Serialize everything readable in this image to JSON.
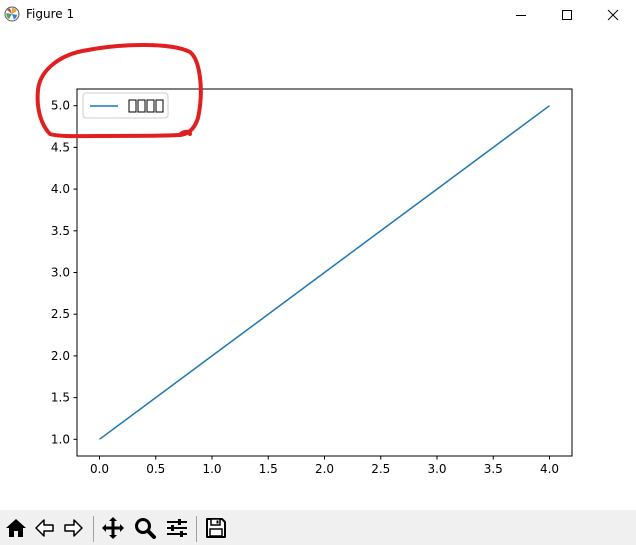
{
  "window": {
    "title": "Figure 1",
    "icons": [
      "matplotlib-logo-icon",
      "minimize-icon",
      "maximize-icon",
      "close-icon"
    ]
  },
  "chart_data": {
    "type": "line",
    "x": [
      0,
      1,
      2,
      3,
      4
    ],
    "series": [
      {
        "name": "□□□□",
        "values": [
          1,
          2,
          3,
          4,
          5
        ],
        "color": "#1f77b4"
      }
    ],
    "xlim": [
      -0.2,
      4.2
    ],
    "ylim": [
      0.8,
      5.2
    ],
    "xticks": [
      0.0,
      0.5,
      1.0,
      1.5,
      2.0,
      2.5,
      3.0,
      3.5,
      4.0
    ],
    "yticks": [
      1.0,
      1.5,
      2.0,
      2.5,
      3.0,
      3.5,
      4.0,
      4.5,
      5.0
    ],
    "xtick_labels": [
      "0.0",
      "0.5",
      "1.0",
      "1.5",
      "2.0",
      "2.5",
      "3.0",
      "3.5",
      "4.0"
    ],
    "ytick_labels": [
      "1.0",
      "1.5",
      "2.0",
      "2.5",
      "3.0",
      "3.5",
      "4.0",
      "4.5",
      "5.0"
    ],
    "legend_position": "upper left",
    "grid": false,
    "annotation": {
      "shape": "hand-drawn circle around legend",
      "color": "#e02020"
    }
  },
  "toolbar": {
    "buttons": [
      "home-icon",
      "back-icon",
      "forward-icon",
      "pan-icon",
      "zoom-icon",
      "configure-subplots-icon",
      "save-icon"
    ]
  }
}
